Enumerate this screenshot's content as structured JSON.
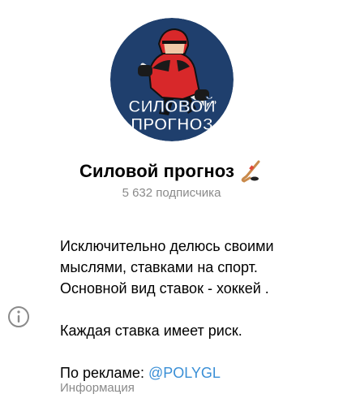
{
  "channel": {
    "avatar_text_line1": "СИЛОВОЙ",
    "avatar_text_line2": "ПРОГНОЗ",
    "name": "Силовой прогноз",
    "title_emoji_icon": "hockey-stick-icon",
    "subscribers": "5 632 подписчика"
  },
  "description": {
    "line1": "Исключительно делюсь своими",
    "line2": "мыслями, ставками на спорт.",
    "line3": "Основной вид ставок - хоккей .",
    "line4": "Каждая ставка имеет риск.",
    "ads_prefix": "По рекламе: ",
    "ads_link": "@POLYGL",
    "section_label": "Информация",
    "section_icon": "info-icon"
  },
  "colors": {
    "avatar_bg": "#1f3f6d",
    "jersey_red": "#d8282a",
    "link": "#3a8fd6",
    "muted_text": "#8a8a8a"
  }
}
